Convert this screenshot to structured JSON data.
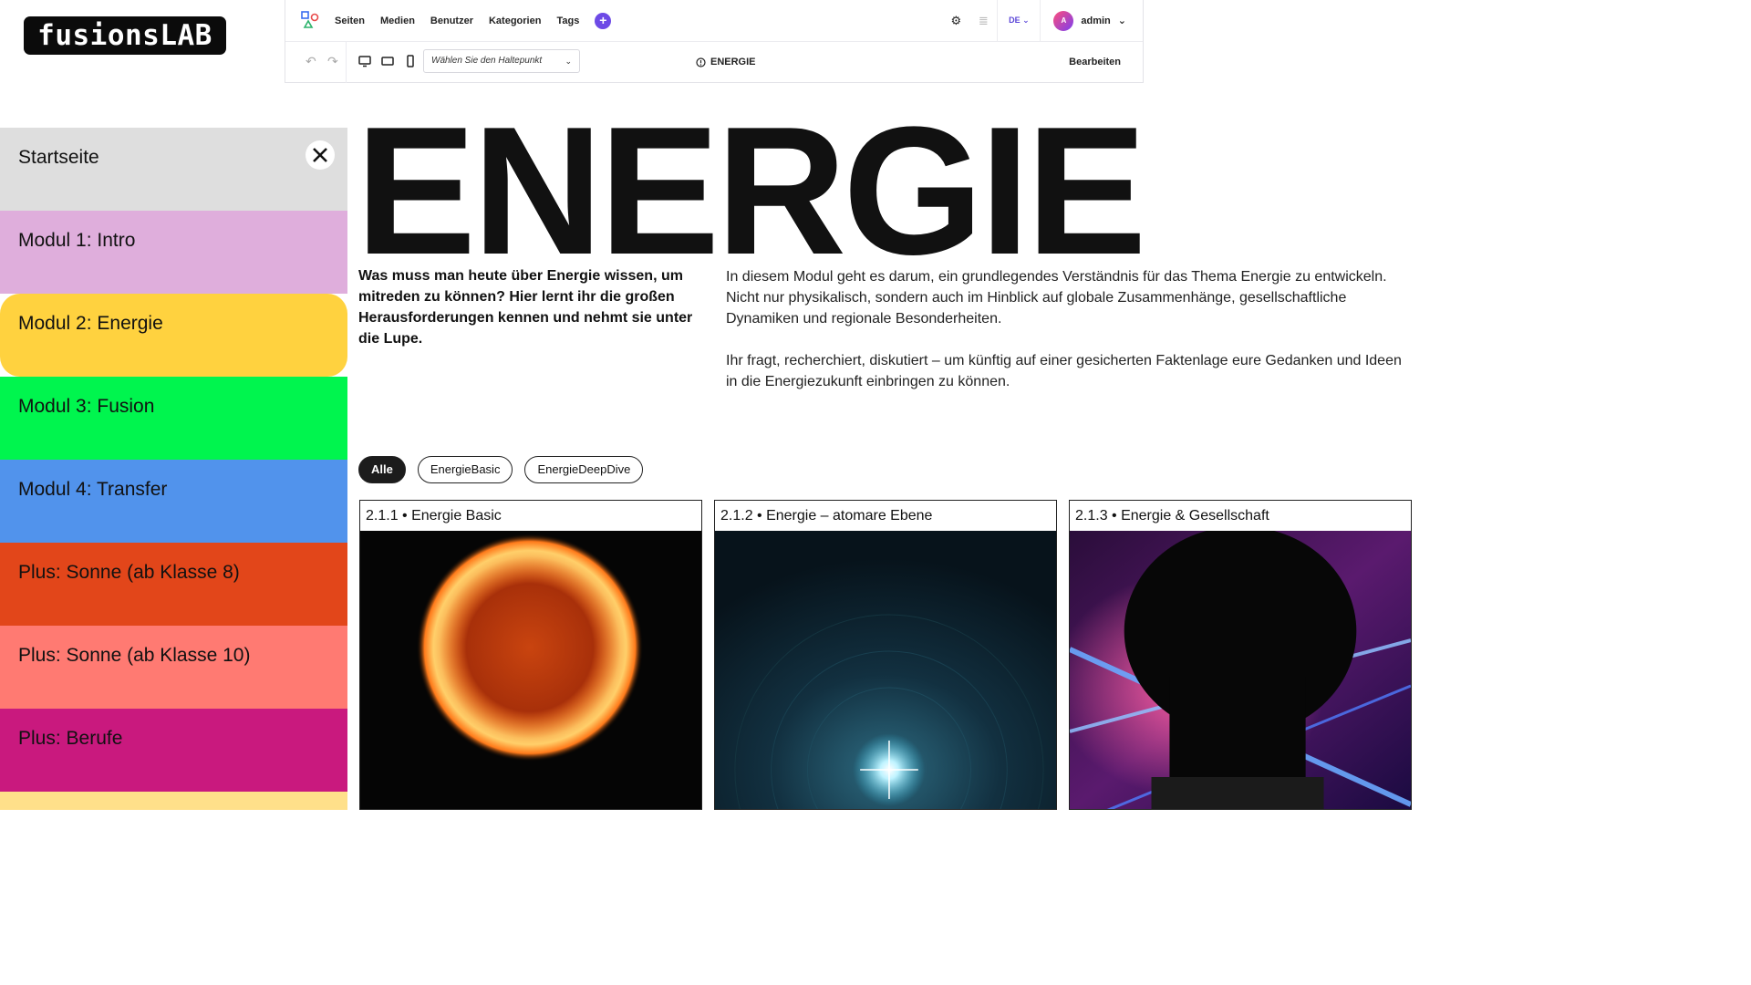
{
  "logo": {
    "text": "fusionsLAB"
  },
  "editor": {
    "nav": [
      "Seiten",
      "Medien",
      "Benutzer",
      "Kategorien",
      "Tags"
    ],
    "add_label": "+",
    "lang": "DE",
    "user": {
      "initial": "A",
      "name": "admin"
    },
    "breakpoint_placeholder": "Wählen Sie den Haltepunkt",
    "page_name": "ENERGIE",
    "edit_label": "Bearbeiten"
  },
  "sidebar": {
    "items": [
      {
        "label": "Startseite",
        "color": "#dedede"
      },
      {
        "label": "Modul 1: Intro",
        "color": "#dfaedc"
      },
      {
        "label": "Modul 2: Energie",
        "color": "#ffd23f",
        "active": true
      },
      {
        "label": "Modul 3: Fusion",
        "color": "#00f54e"
      },
      {
        "label": "Modul 4: Transfer",
        "color": "#5193ec"
      },
      {
        "label": "Plus: Sonne (ab Klasse 8)",
        "color": "#e2461a"
      },
      {
        "label": "Plus: Sonne (ab Klasse 10)",
        "color": "#ff7a72"
      },
      {
        "label": "Plus: Berufe",
        "color": "#c9197e"
      }
    ]
  },
  "page": {
    "title": "ENERGIE",
    "lead": "Was muss man heute über Energie wissen, um mitreden zu können? Hier lernt ihr die großen Herausforderungen kennen und nehmt sie unter die Lupe.",
    "paragraphs": [
      "In diesem Modul geht es darum, ein grundlegendes Verständnis für das Thema Energie zu entwickeln. Nicht nur physikalisch, sondern auch im Hinblick auf globale Zusammenhänge, gesellschaftliche Dynamiken und regionale Besonderheiten.",
      "Ihr fragt, recherchiert, diskutiert – um künftig auf einer gesicherten Faktenlage eure Gedanken und Ideen in die Energiezukunft einbringen zu können."
    ],
    "filters": [
      {
        "label": "Alle",
        "active": true
      },
      {
        "label": "EnergieBasic"
      },
      {
        "label": "EnergieDeepDive"
      }
    ],
    "cards": [
      {
        "title": "2.1.1 • Energie Basic"
      },
      {
        "title": "2.1.2 • Energie – atomare Ebene"
      },
      {
        "title": "2.1.3 • Energie & Gesellschaft"
      }
    ]
  }
}
